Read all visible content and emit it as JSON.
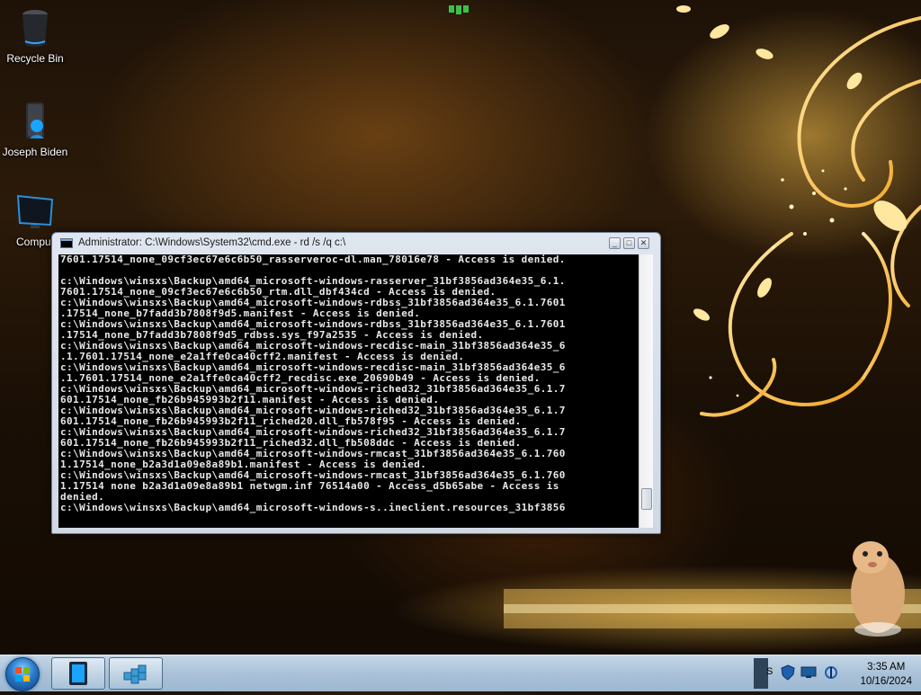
{
  "desktop": {
    "icons": [
      {
        "label": "Recycle Bin",
        "icon": "recycle-bin-icon"
      },
      {
        "label": "Joseph Biden",
        "icon": "user-folder-icon"
      },
      {
        "label": "Comput",
        "icon": "computer-icon"
      }
    ]
  },
  "cmd_window": {
    "title": "Administrator: C:\\Windows\\System32\\cmd.exe - rd  /s /q c:\\",
    "buttons": {
      "minimize": "minimize-icon",
      "maximize": "maximize-icon",
      "close": "close-icon"
    },
    "console_lines": [
      "7601.17514_none_09cf3ec67e6c6b50_rasserveroc-dl.man_78016e78 - Access is denied.",
      "",
      "c:\\Windows\\winsxs\\Backup\\amd64_microsoft-windows-rasserver_31bf3856ad364e35_6.1.",
      "7601.17514_none_09cf3ec67e6c6b50_rtm.dll_dbf434cd - Access is denied.",
      "c:\\Windows\\winsxs\\Backup\\amd64_microsoft-windows-rdbss_31bf3856ad364e35_6.1.7601",
      ".17514_none_b7fadd3b7808f9d5.manifest - Access is denied.",
      "c:\\Windows\\winsxs\\Backup\\amd64_microsoft-windows-rdbss_31bf3856ad364e35_6.1.7601",
      ".17514_none_b7fadd3b7808f9d5_rdbss.sys_f97a2535 - Access is denied.",
      "c:\\Windows\\winsxs\\Backup\\amd64_microsoft-windows-recdisc-main_31bf3856ad364e35_6",
      ".1.7601.17514_none_e2a1ffe0ca40cff2.manifest - Access is denied.",
      "c:\\Windows\\winsxs\\Backup\\amd64_microsoft-windows-recdisc-main_31bf3856ad364e35_6",
      ".1.7601.17514_none_e2a1ffe0ca40cff2_recdisc.exe_20690b49 - Access is denied.",
      "c:\\Windows\\winsxs\\Backup\\amd64_microsoft-windows-riched32_31bf3856ad364e35_6.1.7",
      "601.17514_none_fb26b945993b2f11.manifest - Access is denied.",
      "c:\\Windows\\winsxs\\Backup\\amd64_microsoft-windows-riched32_31bf3856ad364e35_6.1.7",
      "601.17514_none_fb26b945993b2f11_riched20.dll_fb578f95 - Access is denied.",
      "c:\\Windows\\winsxs\\Backup\\amd64_microsoft-windows-riched32_31bf3856ad364e35_6.1.7",
      "601.17514_none_fb26b945993b2f11_riched32.dll_fb508ddc - Access is denied.",
      "c:\\Windows\\winsxs\\Backup\\amd64_microsoft-windows-rmcast_31bf3856ad364e35_6.1.760",
      "1.17514_none_b2a3d1a09e8a89b1.manifest - Access is denied.",
      "c:\\Windows\\winsxs\\Backup\\amd64_microsoft-windows-rmcast_31bf3856ad364e35_6.1.760",
      "1.17514 none b2a3d1a09e8a89b1 netwgm.inf 76514a00 - Access_d5b65abe - Access is",
      "denied.",
      "c:\\Windows\\winsxs\\Backup\\amd64_microsoft-windows-s..ineclient.resources_31bf3856"
    ]
  },
  "taskbar": {
    "start": "start-orb-icon",
    "buttons": [
      {
        "icon": "cmd-icon"
      },
      {
        "icon": "registry-editor-icon"
      }
    ],
    "tray": {
      "partial_label": "S",
      "icons": [
        "action-center-icon",
        "network-icon",
        "volume-icon"
      ],
      "time": "3:35 AM",
      "date": "10/16/2024"
    }
  },
  "colors": {
    "console_bg": "#000000",
    "console_fg": "#e8e8e8",
    "taskbar": "#aac2d8",
    "accent_glow": "#ffc850"
  }
}
